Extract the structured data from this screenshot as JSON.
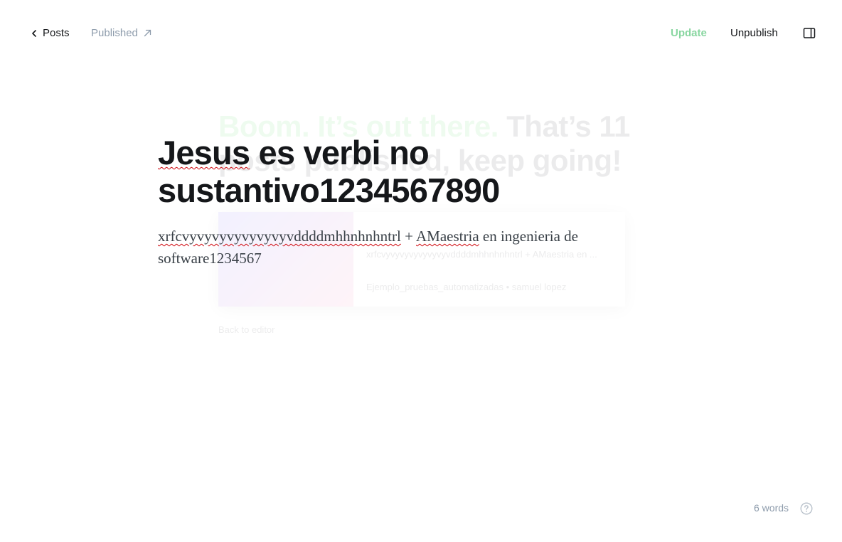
{
  "topbar": {
    "back_label": "Posts",
    "status_label": "Published",
    "update_label": "Update",
    "unpublish_label": "Unpublish",
    "back_icon": "chevron-left-icon",
    "status_icon": "arrow-up-right-icon",
    "sidebar_icon": "sidebar-panel-icon"
  },
  "ghost": {
    "headline_accent": "Boom. It’s out there.",
    "headline_rest": "That’s 11 posts published, keep going!",
    "card_excerpt": "xrfcvyvyvyvyvyvyvyvddddmhhnhnhntrl + AMaestria en ...",
    "card_meta": "Ejemplo_pruebas_automatizadas  •  samuel lopez",
    "back_label": "Back to editor"
  },
  "editor": {
    "title_line1_word": "Jesus",
    "title_line1_rest": " es verbi no",
    "title_line2": "sustantivo1234567890",
    "body_word1": "xrfcvyvyvyvyvyvyvyvddddmhhnhnhntrl",
    "body_mid": " + ",
    "body_word2": "AMaestria",
    "body_rest": " en ingenieria de software1234567"
  },
  "footer": {
    "word_count": "6 words",
    "help_icon": "question-circle-icon"
  },
  "colors": {
    "accent_green": "#88d6a0",
    "muted": "#8e9cac",
    "text": "#15171a",
    "spellcheck": "#d10a10"
  }
}
